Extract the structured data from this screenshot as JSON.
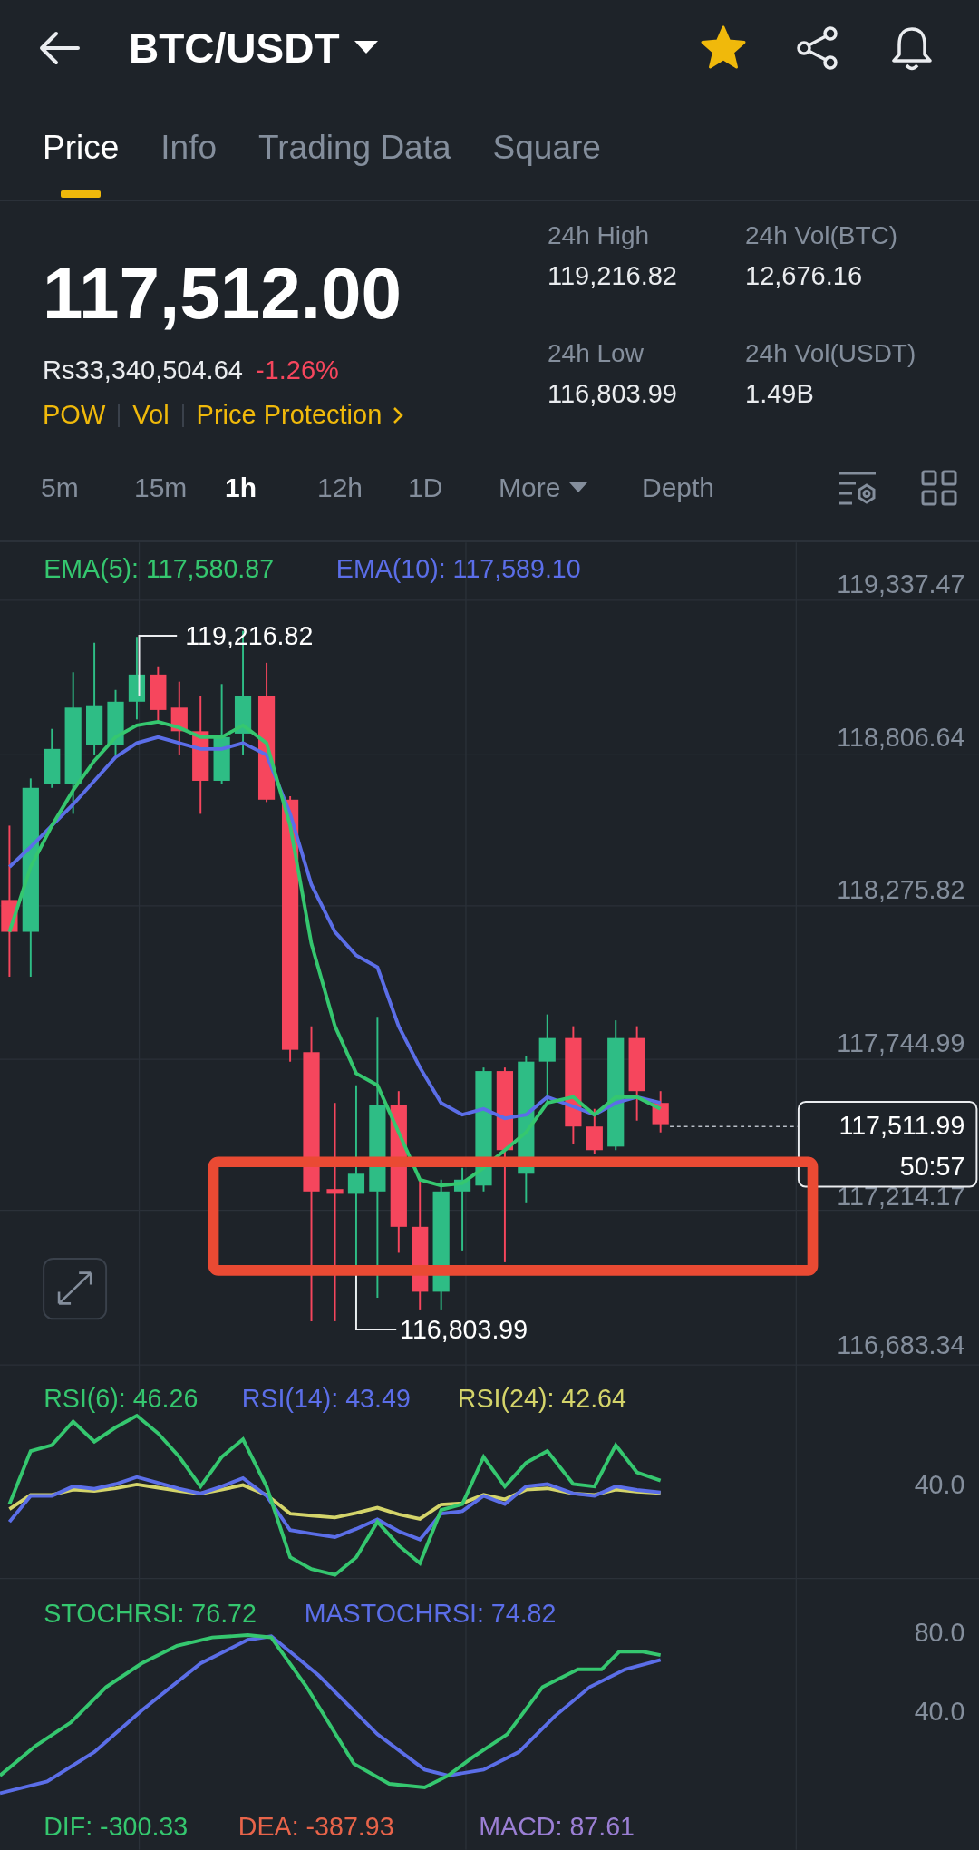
{
  "header": {
    "title": "BTC/USDT",
    "favorite": true
  },
  "tabs": [
    {
      "label": "Price",
      "selected": true
    },
    {
      "label": "Info",
      "selected": false
    },
    {
      "label": "Trading Data",
      "selected": false
    },
    {
      "label": "Square",
      "selected": false
    }
  ],
  "ticker": {
    "last_price": "117,512.00",
    "fiat_price": "Rs33,340,504.64",
    "change": "-1.26%",
    "tags": [
      "POW",
      "Vol",
      "Price Protection"
    ],
    "stats": [
      {
        "label": "24h High",
        "value": "119,216.82"
      },
      {
        "label": "24h Vol(BTC)",
        "value": "12,676.16"
      },
      {
        "label": "24h Low",
        "value": "116,803.99"
      },
      {
        "label": "24h Vol(USDT)",
        "value": "1.49B"
      }
    ]
  },
  "intervals": [
    {
      "label": "5m",
      "selected": false
    },
    {
      "label": "15m",
      "selected": false
    },
    {
      "label": "1h",
      "selected": true
    },
    {
      "label": "12h",
      "selected": false
    },
    {
      "label": "1D",
      "selected": false
    }
  ],
  "more_menu": "More",
  "depth": "Depth",
  "price_chart": {
    "indicators": [
      {
        "label": "EMA(5): 117,580.87",
        "color": "#35c76f"
      },
      {
        "label": "EMA(10): 117,589.10",
        "color": "#5b6ee8"
      }
    ],
    "axis_labels": [
      "119,337.47",
      "118,806.64",
      "118,275.82",
      "117,744.99",
      "117,214.17",
      "116,683.34"
    ],
    "high_marker": "119,216.82",
    "low_marker": "116,803.99",
    "current_price": "117,511.99",
    "countdown": "50:57"
  },
  "rsi": {
    "indicators": [
      {
        "label": "RSI(6): 46.26",
        "color": "#35c76f"
      },
      {
        "label": "RSI(14): 43.49",
        "color": "#5b6ee8"
      },
      {
        "label": "RSI(24): 42.64",
        "color": "#d4d46a"
      }
    ],
    "axis_labels": [
      "40.0"
    ]
  },
  "stochrsi": {
    "indicators": [
      {
        "label": "STOCHRSI: 76.72",
        "color": "#35c76f"
      },
      {
        "label": "MASTOCHRSI: 74.82",
        "color": "#5b6ee8"
      }
    ],
    "axis_labels": [
      "80.0",
      "40.0"
    ]
  },
  "macd": {
    "indicators": [
      {
        "label": "DIF: -300.33",
        "color": "#35c76f"
      },
      {
        "label": "DEA: -387.93",
        "color": "#e8644a"
      },
      {
        "label": "MACD: 87.61",
        "color": "#9b7fd4"
      }
    ]
  }
}
